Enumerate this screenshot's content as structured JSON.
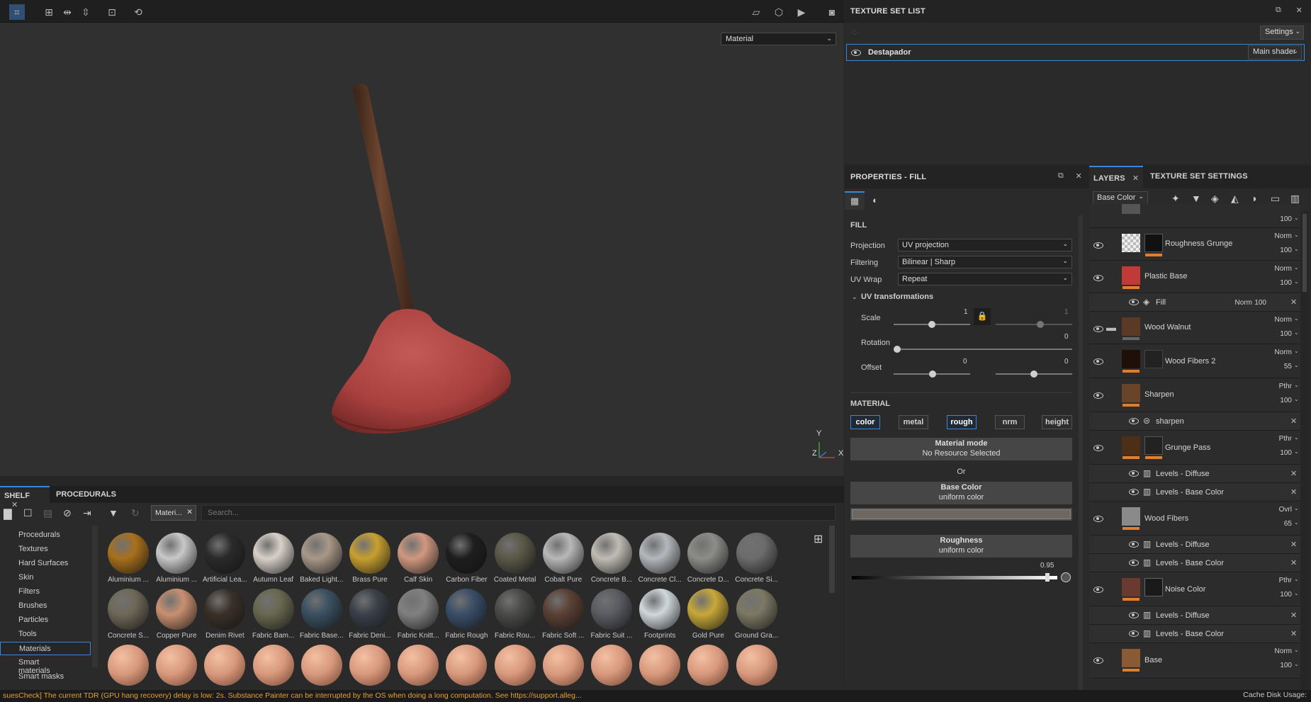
{
  "viewport": {
    "mode_select": "Material",
    "axis_x": "X",
    "axis_y": "Y",
    "axis_z": "Z"
  },
  "shelf": {
    "tabs": [
      "SHELF",
      "PROCEDURALS"
    ],
    "filter_chip": "Materi...",
    "search_placeholder": "Search...",
    "categories": [
      "Procedurals",
      "Textures",
      "Hard Surfaces",
      "Skin",
      "Filters",
      "Brushes",
      "Particles",
      "Tools",
      "Materials",
      "Smart materials",
      "Smart masks"
    ],
    "active_category": "Materials",
    "materials_row1": [
      "Aluminium ...",
      "Aluminium ...",
      "Artificial Lea...",
      "Autumn Leaf",
      "Baked Light...",
      "Brass Pure",
      "Calf Skin",
      "Carbon Fiber",
      "Coated Metal",
      "Cobalt Pure",
      "Concrete B...",
      "Concrete Cl...",
      "Concrete D...",
      "Concrete Si..."
    ],
    "materials_row2": [
      "Concrete S...",
      "Copper Pure",
      "Denim Rivet",
      "Fabric Bam...",
      "Fabric Base...",
      "Fabric Deni...",
      "Fabric Knitt...",
      "Fabric Rough",
      "Fabric Rou...",
      "Fabric Soft ...",
      "Fabric Suit ...",
      "Footprints",
      "Gold Pure",
      "Ground Gra..."
    ],
    "colors_row1": [
      "#a8701c",
      "#c8c8c8",
      "#2a2a2a",
      "#d8d0c8",
      "#a89888",
      "#c8a030",
      "#d09880",
      "#1e1e1e",
      "#5a5848",
      "#b8b8b8",
      "#c0bcb4",
      "#b4b8bc",
      "#8c8c88",
      "#6c6c6c"
    ],
    "colors_row2": [
      "#6e6858",
      "#c89070",
      "#3a3028",
      "#686850",
      "#3a5060",
      "#3a404a",
      "#808080",
      "#3a4e68",
      "#4a4a48",
      "#5a4034",
      "#5a5c62",
      "#d0d8dc",
      "#c8a838",
      "#7c7864"
    ]
  },
  "texture_set_list": {
    "title": "TEXTURE SET LIST",
    "settings": "Settings",
    "set_name": "Destapador",
    "shader": "Main shader"
  },
  "properties": {
    "title": "PROPERTIES - FILL",
    "fill_header": "FILL",
    "projection_label": "Projection",
    "projection_value": "UV projection",
    "filtering_label": "Filtering",
    "filtering_value": "Bilinear | Sharp",
    "uvwrap_label": "UV Wrap",
    "uvwrap_value": "Repeat",
    "uv_transform_label": "UV transformations",
    "scale_label": "Scale",
    "scale_value": "1",
    "scale_value2": "1",
    "rotation_label": "Rotation",
    "rotation_value": "0",
    "offset_label": "Offset",
    "offset_value": "0",
    "offset_value2": "0",
    "material_header": "MATERIAL",
    "channels": [
      "color",
      "metal",
      "rough",
      "nrm",
      "height"
    ],
    "material_mode_title": "Material mode",
    "material_mode_value": "No Resource Selected",
    "or_label": "Or",
    "base_color_title": "Base Color",
    "base_color_value": "uniform color",
    "roughness_title": "Roughness",
    "roughness_value": "uniform color",
    "roughness_number": "0.95",
    "scale_level": 0.5,
    "offset_level": 0.6,
    "roughness_level": 0.95
  },
  "layers": {
    "tabs": [
      "LAYERS",
      "TEXTURE SET SETTINGS"
    ],
    "channel_select": "Base Color",
    "top_opacity": "100",
    "items": [
      {
        "name": "Roughness Grunge",
        "blend": "Norm",
        "opacity": "100"
      },
      {
        "name": "Plastic Base",
        "blend": "Norm",
        "opacity": "100"
      },
      {
        "name": "Wood Walnut",
        "blend": "Norm",
        "opacity": "100"
      },
      {
        "name": "Wood Fibers 2",
        "blend": "Norm",
        "opacity": "55"
      },
      {
        "name": "Sharpen",
        "blend": "Pthr",
        "opacity": "100"
      },
      {
        "name": "Grunge Pass",
        "blend": "Pthr",
        "opacity": "100"
      },
      {
        "name": "Wood Fibers",
        "blend": "Ovrl",
        "opacity": "65"
      },
      {
        "name": "Noise Color",
        "blend": "Pthr",
        "opacity": "100"
      },
      {
        "name": "Base",
        "blend": "Norm",
        "opacity": "100"
      }
    ],
    "subs": {
      "fill": {
        "name": "Fill",
        "blend": "Norm",
        "opacity": "100"
      },
      "sharpen": "sharpen",
      "levels_diffuse": "Levels - Diffuse",
      "levels_base": "Levels - Base Color"
    }
  },
  "status": {
    "message": "suesCheck] The current TDR (GPU hang recovery) delay is low: 2s. Substance Painter can be interrupted by the OS when doing a long computation. See https://support.alleg...",
    "cache": "Cache Disk Usage:"
  }
}
